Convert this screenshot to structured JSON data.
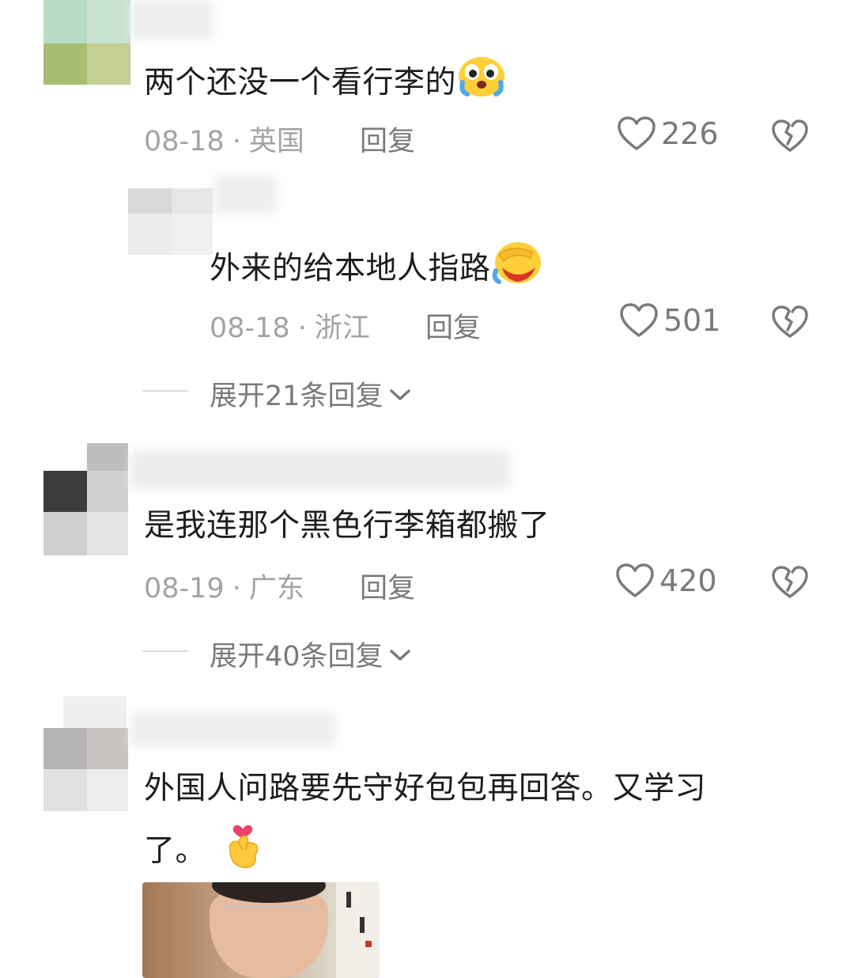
{
  "comments": [
    {
      "text": "两个还没一个看行李的",
      "emoji": "cry-laughing-face-emoji",
      "date": "08-18",
      "location": "英国",
      "reply_label": "回复",
      "likes": "226"
    },
    {
      "text": "外来的给本地人指路",
      "emoji": "facepalm-laughing-face-emoji",
      "date": "08-18",
      "location": "浙江",
      "reply_label": "回复",
      "likes": "501",
      "expand_label": "展开21条回复"
    },
    {
      "text": "是我连那个黑色行李箱都搬了",
      "date": "08-19",
      "location": "广东",
      "reply_label": "回复",
      "likes": "420",
      "expand_label": "展开40条回复"
    },
    {
      "text_line1": "外国人问路要先守好包包再回答。又学习",
      "text_line2": "了。",
      "emoji": "finger-heart-emoji"
    }
  ],
  "separator": "·",
  "colors": {
    "text": "#1d1d1f",
    "meta": "#a3a3a3",
    "action": "#7a7a7a",
    "divider": "#dcdcdc"
  }
}
